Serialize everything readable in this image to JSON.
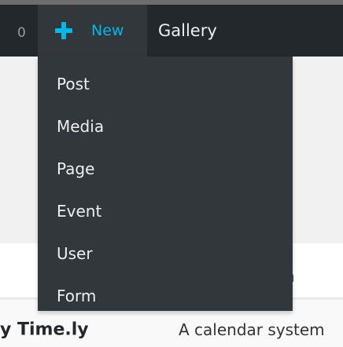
{
  "admin_bar": {
    "count": "0",
    "new_label": "New",
    "gallery_label": "Gallery",
    "new_icon": "plus-icon",
    "accent_color": "#00b9eb"
  },
  "new_menu": {
    "items": [
      {
        "label": "Post"
      },
      {
        "label": "Media"
      },
      {
        "label": "Page"
      },
      {
        "label": "Event"
      },
      {
        "label": "User"
      },
      {
        "label": "Form"
      }
    ]
  },
  "background": {
    "row_fragment": "n",
    "plugin_name": "y Time.ly",
    "plugin_desc": "A calendar system"
  }
}
